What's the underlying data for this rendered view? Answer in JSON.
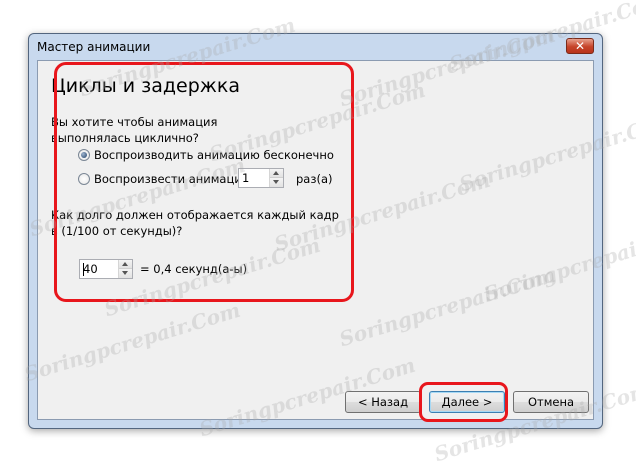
{
  "window": {
    "title": "Мастер анимации",
    "close_glyph": "✕"
  },
  "page": {
    "heading": "Циклы и задержка",
    "loop_question_line1": "Вы хотите чтобы анимация",
    "loop_question_line2": "выполнялась циклично?",
    "option_infinite": "Воспроизводить анимацию бесконечно",
    "option_times_prefix": "Воспроизвести анимаци",
    "option_times_value": "1",
    "option_times_suffix": "раз(а)",
    "delay_question_line1": "Как долго должен отображается каждый кадр",
    "delay_question_line2": "в (1/100 от секунды)?",
    "delay_value": "40",
    "delay_result": "= 0,4 секунд(а-ы)",
    "selected_option": "infinite"
  },
  "buttons": {
    "back": "< Назад",
    "next": "Далее >",
    "cancel": "Отмена"
  },
  "watermark": "Soringpcrepair.Com",
  "colors": {
    "highlight": "#e8161c",
    "titlebar": "#c8d9ee",
    "close": "#c6442a"
  }
}
